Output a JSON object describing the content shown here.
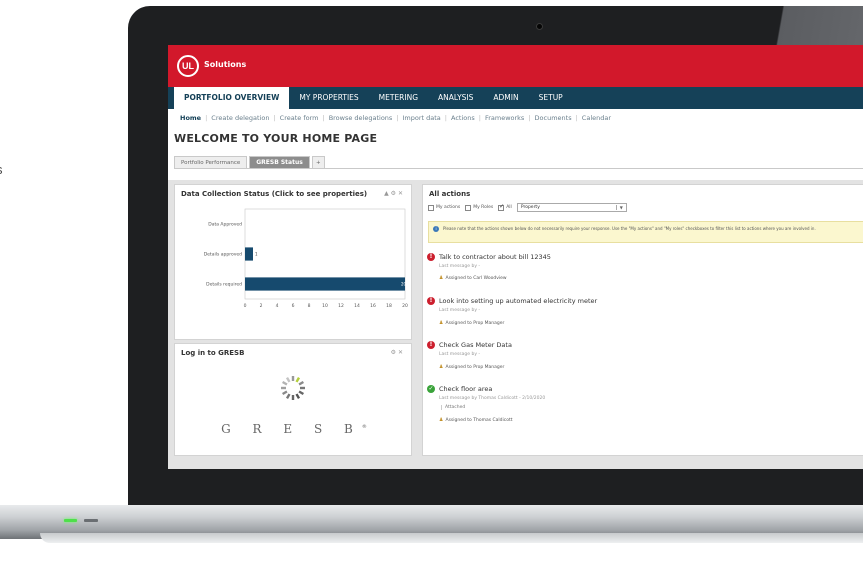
{
  "page": {
    "cut_text": "s"
  },
  "brand": {
    "logo": "UL",
    "name": "Solutions"
  },
  "nav": {
    "tabs": [
      "PORTFOLIO OVERVIEW",
      "MY PROPERTIES",
      "METERING",
      "ANALYSIS",
      "ADMIN",
      "SETUP"
    ],
    "active": "PORTFOLIO OVERVIEW"
  },
  "subnav": {
    "items": [
      "Home",
      "Create delegation",
      "Create form",
      "Browse delegations",
      "Import data",
      "Actions",
      "Frameworks",
      "Documents",
      "Calendar"
    ],
    "active": "Home"
  },
  "page_title": "WELCOME TO YOUR HOME PAGE",
  "portfolio_tabs": {
    "items": [
      "Portfolio Performance",
      "GRESB Status",
      "+"
    ],
    "active": "GRESB Status"
  },
  "data_collection": {
    "title": "Data Collection Status (Click to see properties)",
    "controls": "▲ ⚙ ✕",
    "chart_data": {
      "type": "bar",
      "orientation": "horizontal",
      "categories": [
        "Data Approved",
        "Details approved",
        "Details required"
      ],
      "values": [
        0,
        1,
        20
      ],
      "data_labels": [
        "",
        "1",
        "20"
      ],
      "xlim": [
        0,
        20
      ],
      "xticks": [
        0,
        2,
        4,
        6,
        8,
        10,
        12,
        14,
        16,
        18,
        20
      ],
      "bar_color": "#164a6e",
      "grid": false
    }
  },
  "gresb_login": {
    "title": "Log in to GRESB",
    "controls": "⚙ ✕",
    "wordmark": "G R E S B",
    "trademark": "®"
  },
  "actions_panel": {
    "title": "All actions",
    "filters": [
      {
        "label": "My actions",
        "checked": false
      },
      {
        "label": "My Roles",
        "checked": false
      },
      {
        "label": "All",
        "checked": true
      }
    ],
    "select_value": "Property",
    "note": "Please note that the actions shown below do not necessarily require your response. Use the \"My actions\" and \"My roles\" checkboxes to filter this list to actions where you are involved in.",
    "items": [
      {
        "status": "alert",
        "title": "Talk to contractor about bill 12345",
        "sub": "Last message by -",
        "assigned": "Assigned to Carl Woodview",
        "attachment": ""
      },
      {
        "status": "alert",
        "title": "Look into setting up automated electricity meter",
        "sub": "Last message by -",
        "assigned": "Assigned to Prop Manager",
        "attachment": ""
      },
      {
        "status": "alert",
        "title": "Check Gas Meter Data",
        "sub": "Last message by -",
        "assigned": "Assigned to Prop Manager",
        "attachment": ""
      },
      {
        "status": "done",
        "title": "Check floor area",
        "sub": "Last message by Thomas Caldicott - 2/10/2020",
        "assigned": "Assigned to Thomas Caldicott",
        "attachment": "Attached"
      }
    ]
  },
  "colors": {
    "brand_red": "#d2182b",
    "nav_dark": "#154158",
    "bar": "#164a6e",
    "alert": "#cc1f2e",
    "done": "#3aa33a",
    "led": "#4ee04a"
  }
}
